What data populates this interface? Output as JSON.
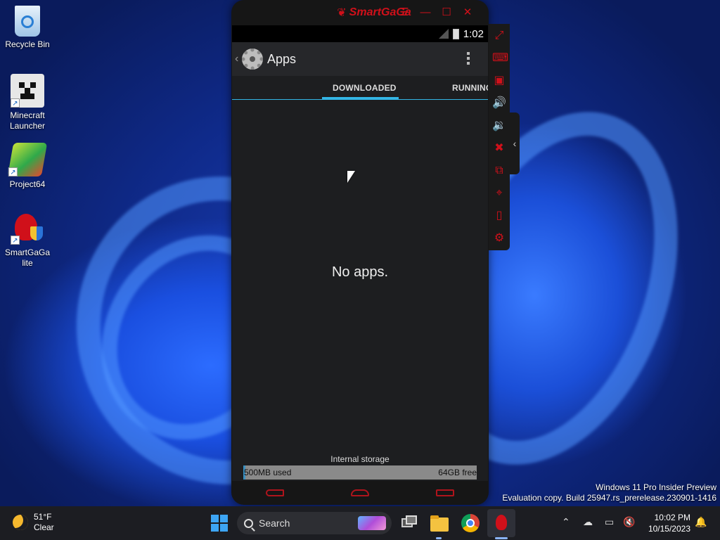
{
  "desktop": {
    "icons": [
      {
        "label": "Recycle Bin"
      },
      {
        "label": "Minecraft Launcher"
      },
      {
        "label": "Project64"
      },
      {
        "label": "SmartGaGa lite"
      }
    ],
    "watermark": {
      "line1": "Windows 11 Pro Insider Preview",
      "line2": "Evaluation copy. Build 25947.rs_prerelease.230901-1416"
    }
  },
  "emulator": {
    "title": "SmartGaGa",
    "controls": {
      "menu": "☰",
      "minimize": "—",
      "maximize": "☐",
      "close": "✕"
    },
    "status_bar": {
      "time": "1:02"
    },
    "action_bar": {
      "title": "Apps"
    },
    "tabs": [
      {
        "label": "DOWNLOADED",
        "selected": true
      },
      {
        "label": "RUNNING",
        "selected": false
      }
    ],
    "empty_message": "No apps.",
    "storage": {
      "label": "Internal storage",
      "used": "500MB used",
      "free": "64GB free",
      "used_fraction": 0.01
    },
    "side_toolbar": [
      "fullscreen-icon",
      "keyboard-icon",
      "apk-install-icon",
      "volume-up-icon",
      "volume-down-icon",
      "keymapping-icon",
      "multi-instance-icon",
      "location-icon",
      "shake-icon",
      "settings-icon"
    ],
    "accent_color": "#d0101a",
    "tab_indicator_color": "#33b5e5"
  },
  "taskbar": {
    "weather": {
      "temp": "51°F",
      "condition": "Clear"
    },
    "search_label": "Search",
    "clock": {
      "time": "10:02 PM",
      "date": "10/15/2023"
    }
  }
}
